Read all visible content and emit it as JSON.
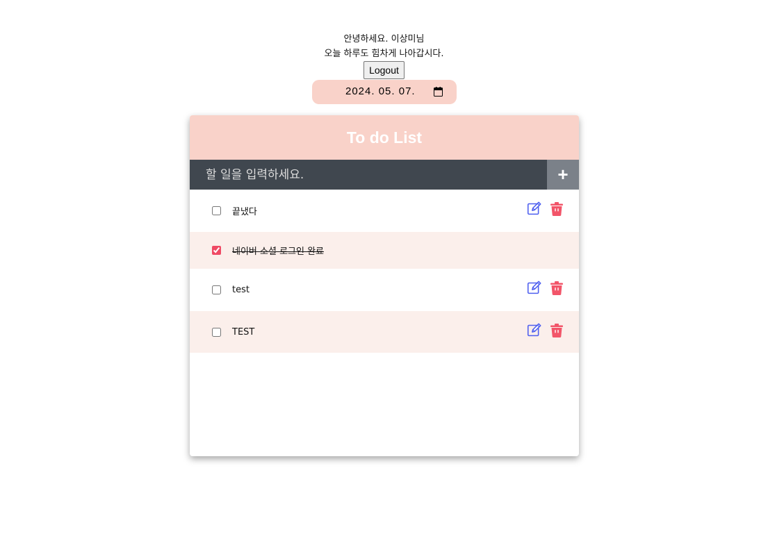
{
  "header": {
    "greeting_line1": "안녕하세요. 이상미님",
    "greeting_line2": "오늘 하루도 힘차게 나아갑시다.",
    "logout_label": "Logout",
    "date_value": "2024. 05. 07."
  },
  "card": {
    "title": "To do List",
    "input_placeholder": "할 일을 입력하세요.",
    "add_label": "+"
  },
  "todos": [
    {
      "text": "끝냈다",
      "checked": false
    },
    {
      "text": "네이버 소셜 로그인 완료",
      "checked": true
    },
    {
      "text": "test",
      "checked": false
    },
    {
      "text": "TEST",
      "checked": false
    }
  ],
  "colors": {
    "accent_pink": "#f9d2c9",
    "row_alt": "#fbefeb",
    "input_bar": "#40474f",
    "add_button": "#7b8189",
    "edit_icon": "#4e5fef",
    "delete_icon": "#f25569"
  },
  "icons": {
    "edit": "pencil-square-icon",
    "delete": "trash-icon",
    "calendar": "calendar-icon"
  }
}
